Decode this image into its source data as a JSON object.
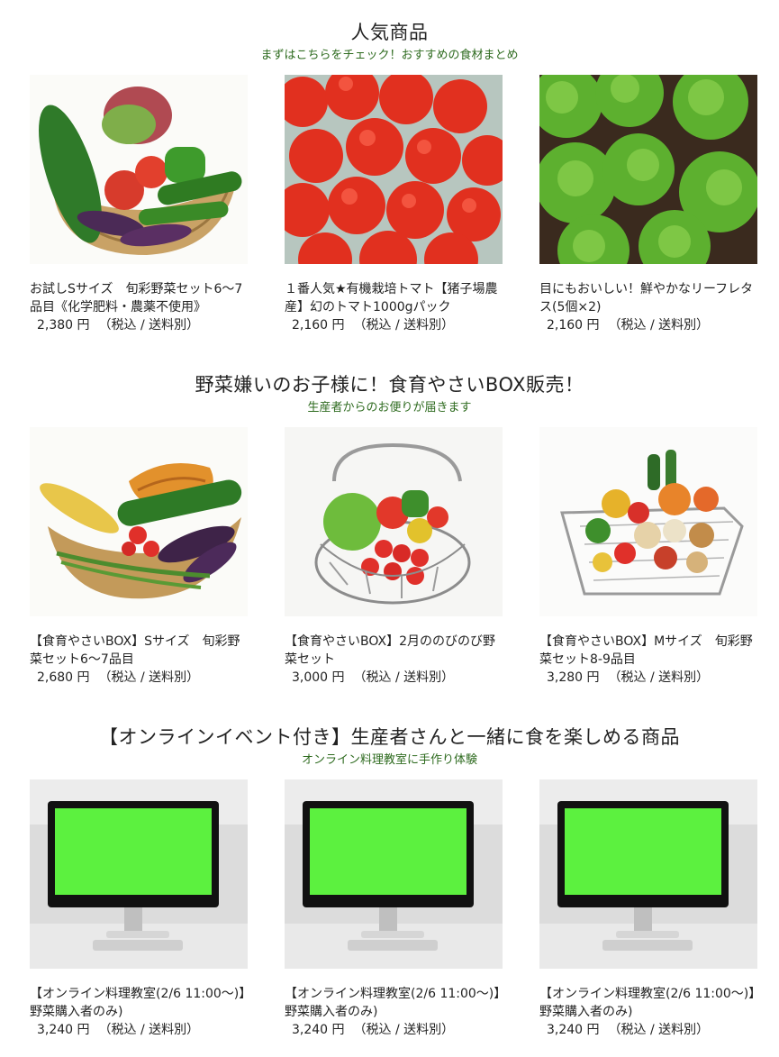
{
  "sections": [
    {
      "title": "人気商品",
      "subtitle": "まずはこちらをチェック！おすすめの食材まとめ",
      "products": [
        {
          "name": "お試しSサイズ　旬彩野菜セット6～7品目《化学肥料・農薬不使用》",
          "price": "2,380 円",
          "tax": "（税込 / 送料別）",
          "image": "vegetable-basket-photo"
        },
        {
          "name": "１番人気★有機栽培トマト【猪子場農産】幻のトマト1000gパック",
          "price": "2,160 円",
          "tax": "（税込 / 送料別）",
          "image": "tomatoes-photo"
        },
        {
          "name": "目にもおいしい！鮮やかなリーフレタス(5個×2)",
          "price": "2,160 円",
          "tax": "（税込 / 送料別）",
          "image": "leaf-lettuce-photo"
        }
      ]
    },
    {
      "title": "野菜嫌いのお子様に！食育やさいBOX販売！",
      "subtitle": "生産者からのお便りが届きます",
      "products": [
        {
          "name": "【食育やさいBOX】Sサイズ　旬彩野菜セット6～7品目",
          "price": "2,680 円",
          "tax": "（税込 / 送料別）",
          "image": "vegetable-basket-photo"
        },
        {
          "name": "【食育やさいBOX】2月ののびのび野菜セット",
          "price": "3,000 円",
          "tax": "（税込 / 送料別）",
          "image": "wire-basket-photo"
        },
        {
          "name": "【食育やさいBOX】Mサイズ　旬彩野菜セット8-9品目",
          "price": "3,280 円",
          "tax": "（税込 / 送料別）",
          "image": "shopping-basket-photo"
        }
      ]
    },
    {
      "title": "【オンラインイベント付き】生産者さんと一緒に食を楽しめる商品",
      "subtitle": "オンライン料理教室に手作り体験",
      "products": [
        {
          "name": "【オンライン料理教室(2/6 11:00～)】野菜購入者のみ)",
          "price": "3,240 円",
          "tax": "（税込 / 送料別）",
          "image": "monitor-photo"
        },
        {
          "name": "【オンライン料理教室(2/6 11:00～)】野菜購入者のみ)",
          "price": "3,240 円",
          "tax": "（税込 / 送料別）",
          "image": "monitor-photo"
        },
        {
          "name": "【オンライン料理教室(2/6 11:00～)】野菜購入者のみ)",
          "price": "3,240 円",
          "tax": "（税込 / 送料別）",
          "image": "monitor-photo"
        }
      ]
    }
  ],
  "colors": {
    "subtitle": "#2e6b1f",
    "text": "#222222",
    "screen": "#5cf13f"
  }
}
